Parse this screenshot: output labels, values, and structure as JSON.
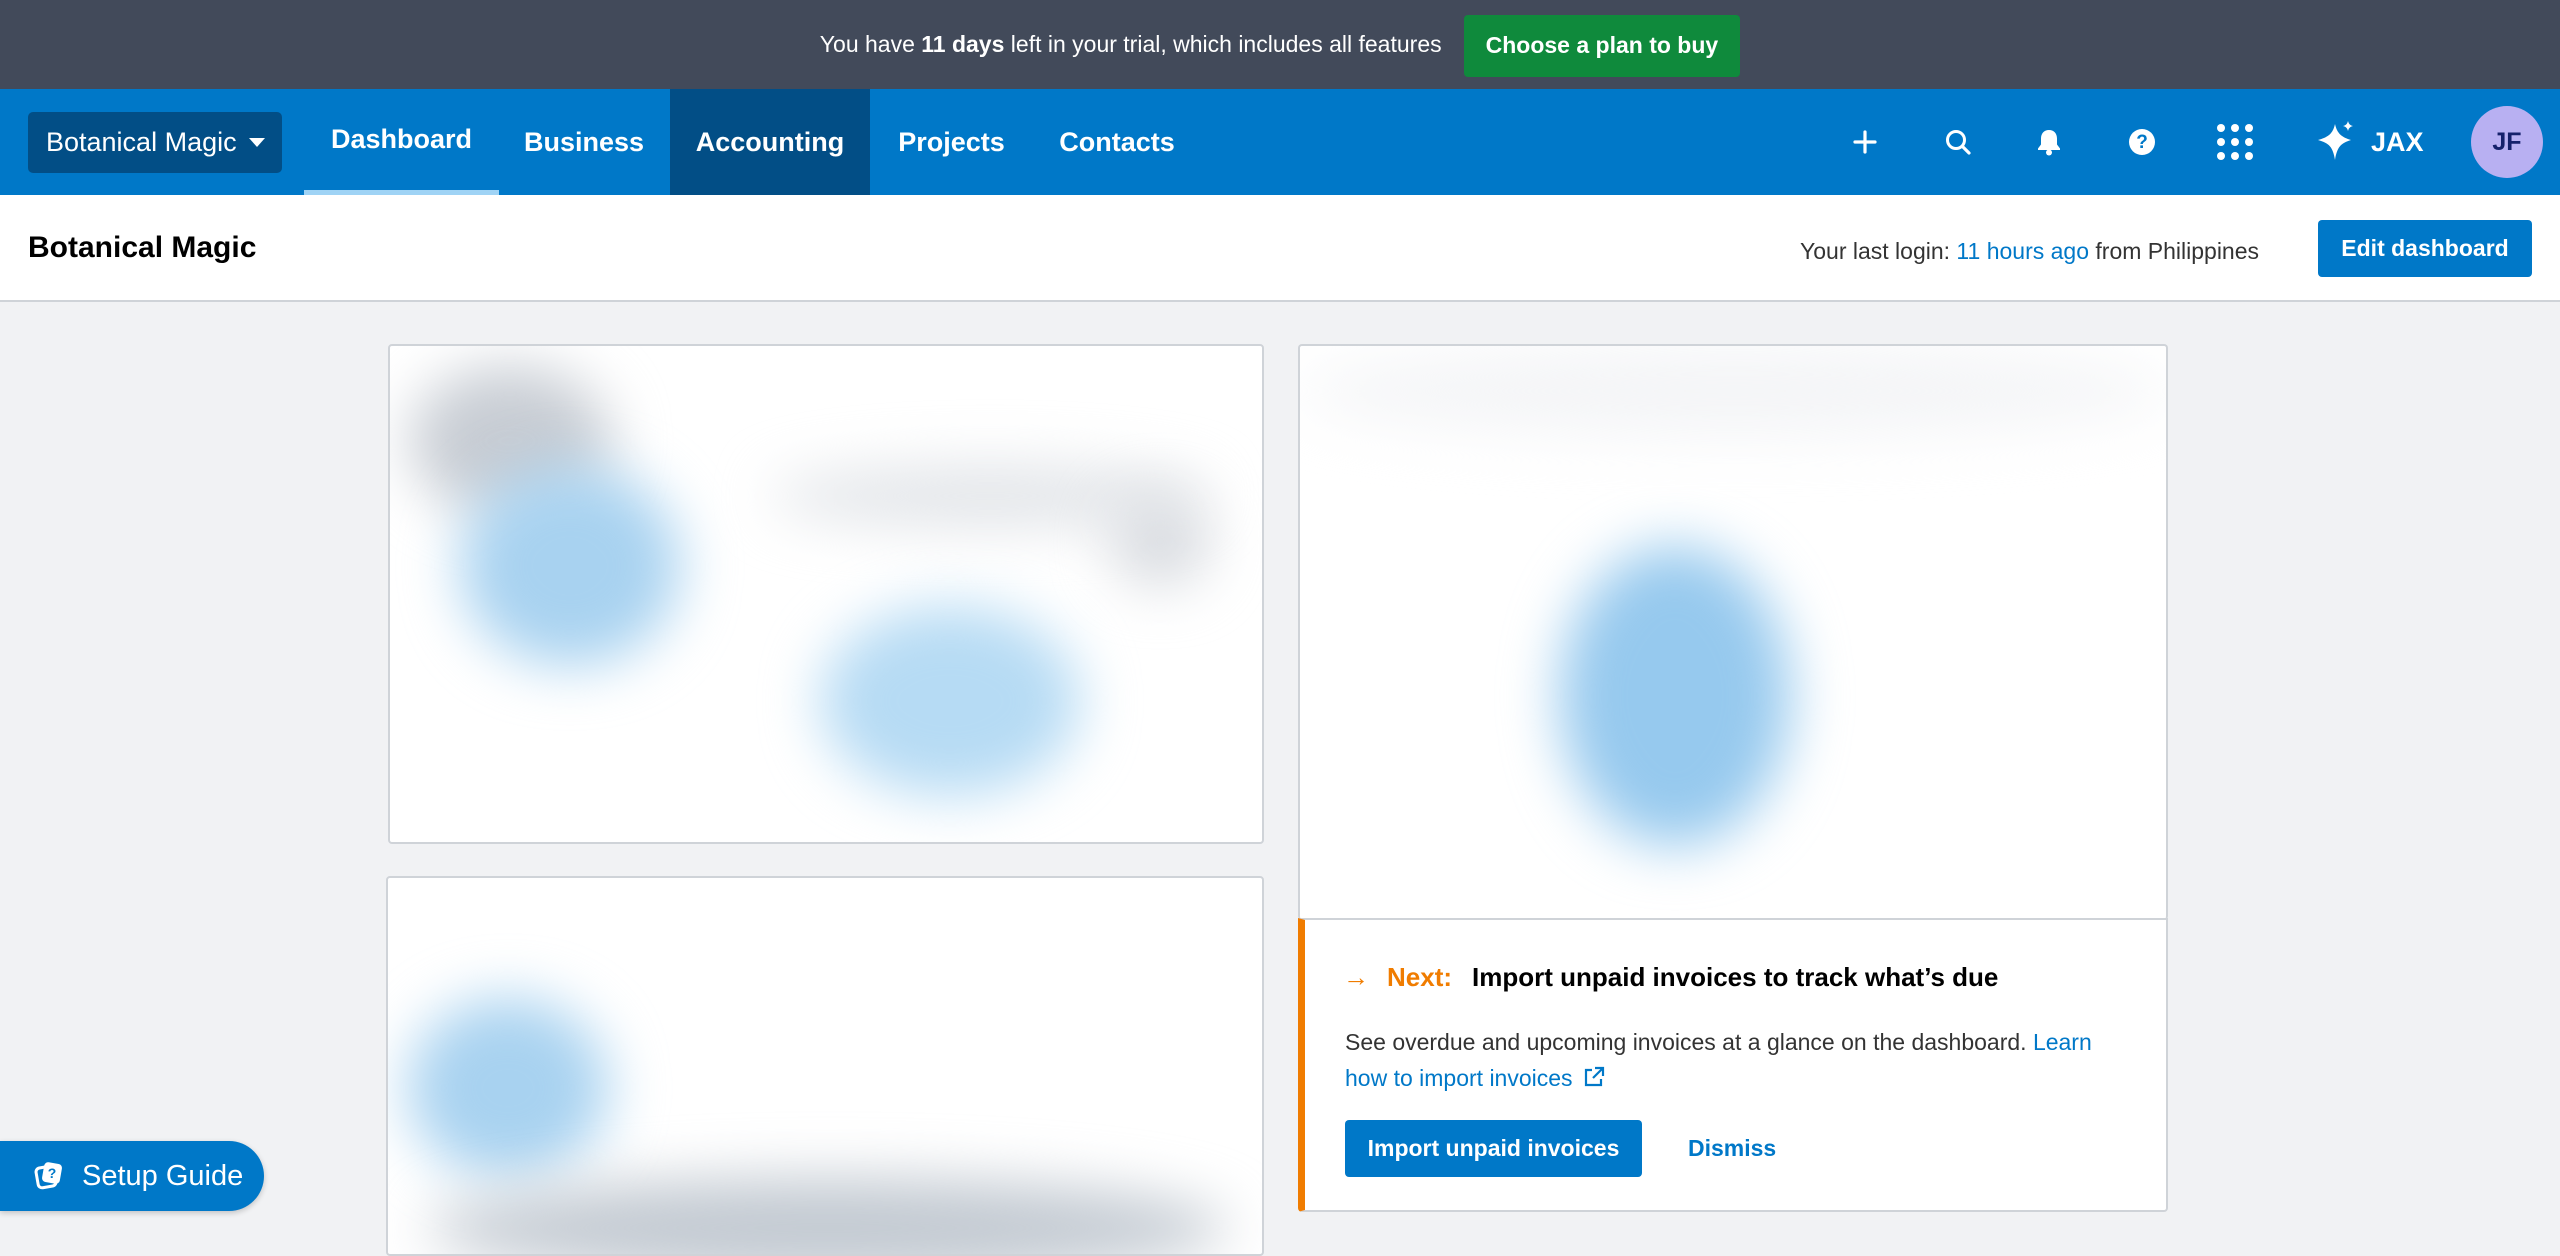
{
  "trial_banner": {
    "text_before": "You have ",
    "days": "11 days",
    "text_after": " left in your trial, which includes all features",
    "button_label": "Choose a plan to buy"
  },
  "nav": {
    "org_name": "Botanical Magic",
    "tabs": [
      "Dashboard",
      "Business",
      "Accounting",
      "Projects",
      "Contacts"
    ],
    "selected_tab": "Dashboard",
    "highlighted_tab": "Accounting",
    "icons": [
      "plus-icon",
      "search-icon",
      "bell-icon",
      "help-icon",
      "apps-grid-icon",
      "sparkle-icon"
    ],
    "jax_label": "JAX",
    "avatar_initials": "JF"
  },
  "subheader": {
    "title": "Botanical Magic",
    "last_login_prefix": "Your last login: ",
    "last_login_time": "11 hours ago",
    "last_login_suffix": " from Philippines",
    "edit_button": "Edit dashboard"
  },
  "next_card": {
    "label": "Next:",
    "title": "Import unpaid invoices to track what’s due",
    "description": "See overdue and upcoming invoices at a glance on the dashboard. ",
    "link_text": "Learn how to import invoices",
    "primary_button": "Import unpaid invoices",
    "secondary_button": "Dismiss"
  },
  "setup_guide": {
    "label": "Setup Guide"
  },
  "colors": {
    "brand_blue": "#0078c8",
    "nav_dark": "#024e86",
    "trial_bg": "#424a5a",
    "buy_green": "#0f8a3c",
    "next_orange": "#f07c00",
    "avatar_bg": "#b8b0f2"
  }
}
